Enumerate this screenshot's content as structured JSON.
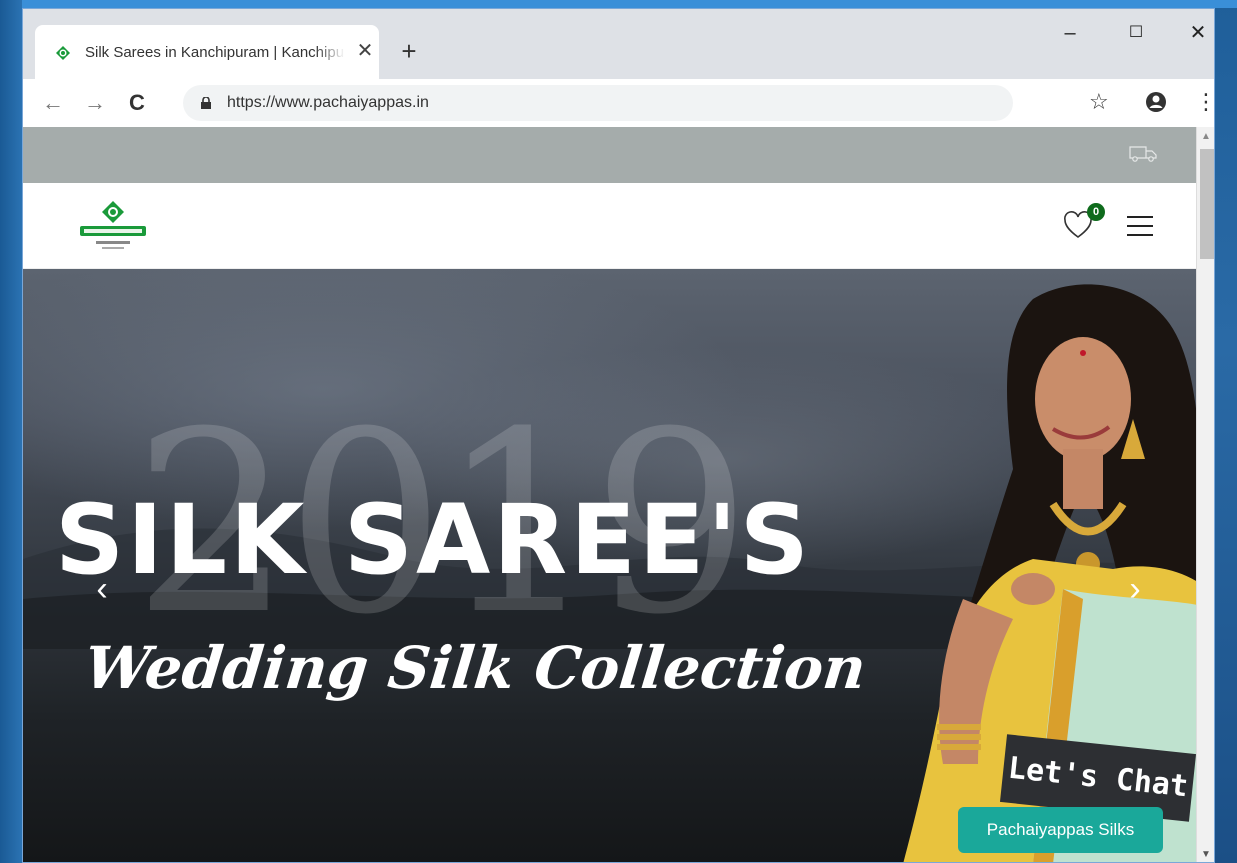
{
  "browser": {
    "tab_title": "Silk Sarees in Kanchipuram | Kanchipuram",
    "tab_close": "✕",
    "new_tab": "+",
    "minimize": "–",
    "maximize": "☐",
    "close": "✕",
    "back": "←",
    "forward": "→",
    "reload": "C",
    "url": "https://www.pachaiyappas.in",
    "bookmark": "☆",
    "menu": "⋮"
  },
  "header": {
    "wishlist_count": "0"
  },
  "hero": {
    "year": "2019",
    "headline": "SILK SAREE'S",
    "subline": "Wedding Silk Collection",
    "prev": "‹",
    "next": "›"
  },
  "chat": {
    "title": "Let's Chat",
    "subtitle": "Pachaiyappas Silks"
  },
  "scrollbar": {
    "up": "▲",
    "down": "▼"
  },
  "colors": {
    "brand_green": "#0e6b1c",
    "chat_teal": "#1aa89a",
    "topbar_grey": "#a5acab"
  }
}
